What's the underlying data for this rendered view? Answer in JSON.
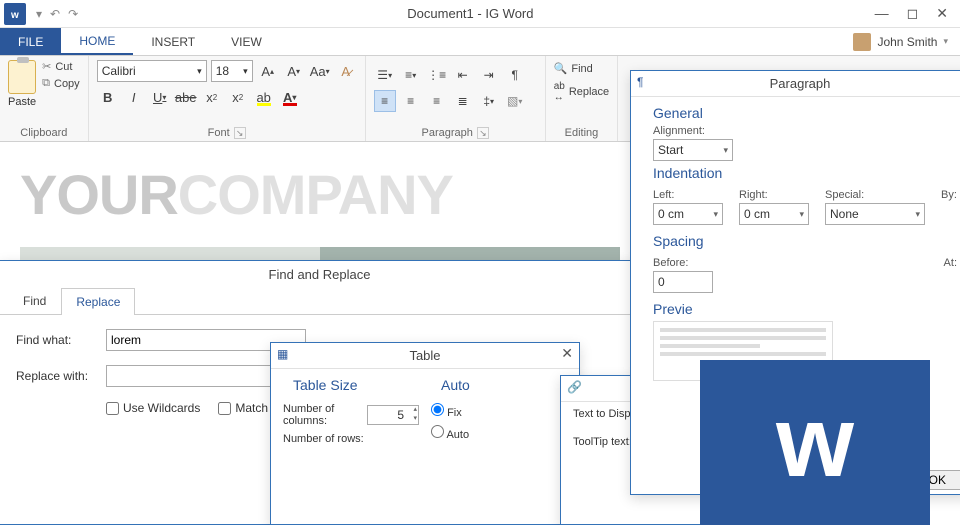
{
  "titlebar": {
    "title": "Document1 - IG Word"
  },
  "tabs": {
    "file": "FILE",
    "home": "HOME",
    "insert": "INSERT",
    "view": "VIEW"
  },
  "user": {
    "name": "John Smith"
  },
  "ribbon": {
    "clipboard": {
      "paste": "Paste",
      "cut": "Cut",
      "copy": "Copy",
      "label": "Clipboard"
    },
    "font": {
      "name": "Calibri",
      "size": "18",
      "label": "Font"
    },
    "paragraph": {
      "label": "Paragraph"
    },
    "editing": {
      "find": "Find",
      "replace": "Replace",
      "label": "Editing"
    }
  },
  "doc": {
    "wm_a": "YOUR",
    "wm_b": "COMPANY"
  },
  "findreplace": {
    "title": "Find and Replace",
    "tab_find": "Find",
    "tab_replace": "Replace",
    "findwhat": "Find what:",
    "findval": "lorem",
    "replacewith": "Replace with:",
    "wildcards": "Use Wildcards",
    "matchcase": "Match C"
  },
  "table": {
    "title": "Table",
    "size_head": "Table Size",
    "numcols": "Number of columns:",
    "cols": "5",
    "numrows": "Number of rows:",
    "auto_head": "Auto",
    "fix": "Fix",
    "auto2": "Auto"
  },
  "paragraphdlg": {
    "title": "Paragraph",
    "general": "General",
    "alignment_lbl": "Alignment:",
    "alignment": "Start",
    "indent": "Indentation",
    "left_lbl": "Left:",
    "left": "0 cm",
    "right_lbl": "Right:",
    "right": "0 cm",
    "special_lbl": "Special:",
    "special": "None",
    "by_lbl": "By:",
    "spacing": "Spacing",
    "before_lbl": "Before:",
    "before": "0",
    "at_lbl": "At:",
    "preview": "Previe"
  },
  "hyperlink": {
    "text_lbl": "Text to Display:",
    "tooltip_lbl": "ToolTip text:"
  },
  "ok": "OK",
  "bigw": "w"
}
